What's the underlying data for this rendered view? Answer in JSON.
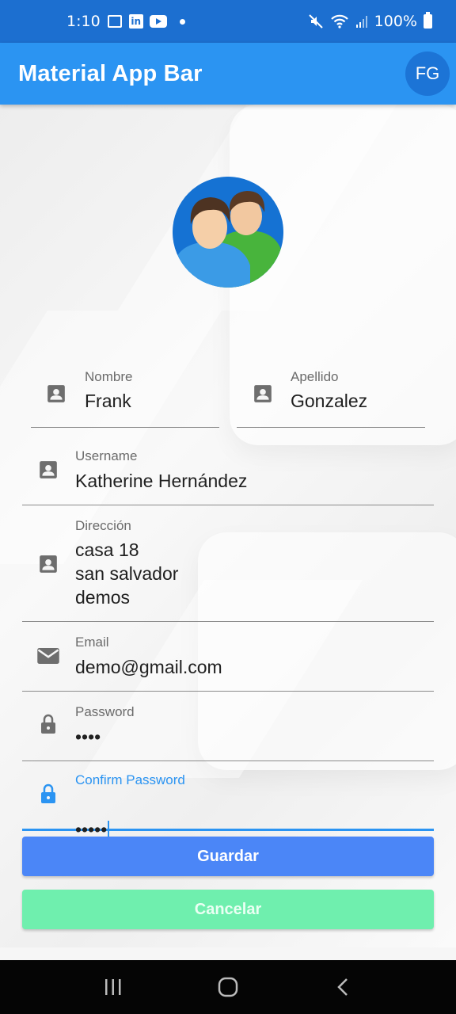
{
  "status_bar": {
    "time": "1:10",
    "battery": "100%"
  },
  "app_bar": {
    "title": "Material App Bar",
    "avatar_initials": "FG"
  },
  "form": {
    "nombre": {
      "label": "Nombre",
      "value": "Frank"
    },
    "apellido": {
      "label": "Apellido",
      "value": "Gonzalez"
    },
    "username": {
      "label": "Username",
      "value": "Katherine Hernández"
    },
    "direccion": {
      "label": "Dirección",
      "value": "casa 18\nsan salvador\ndemos"
    },
    "email": {
      "label": "Email",
      "value": "demo@gmail.com"
    },
    "password": {
      "label": "Password",
      "value": "••••"
    },
    "confirm_password": {
      "label": "Confirm Password",
      "value": "•••••"
    }
  },
  "buttons": {
    "save": "Guardar",
    "cancel": "Cancelar"
  },
  "colors": {
    "primary": "#2b94f2",
    "status": "#1c6fd0",
    "save": "#4b86f7",
    "cancel": "#6fefae"
  },
  "icons": [
    "image-icon",
    "linkedin-icon",
    "youtube-icon",
    "mute-icon",
    "wifi-icon",
    "signal-icon",
    "battery-icon",
    "person-box-icon",
    "email-icon",
    "lock-icon",
    "recents-icon",
    "home-icon",
    "back-icon"
  ]
}
